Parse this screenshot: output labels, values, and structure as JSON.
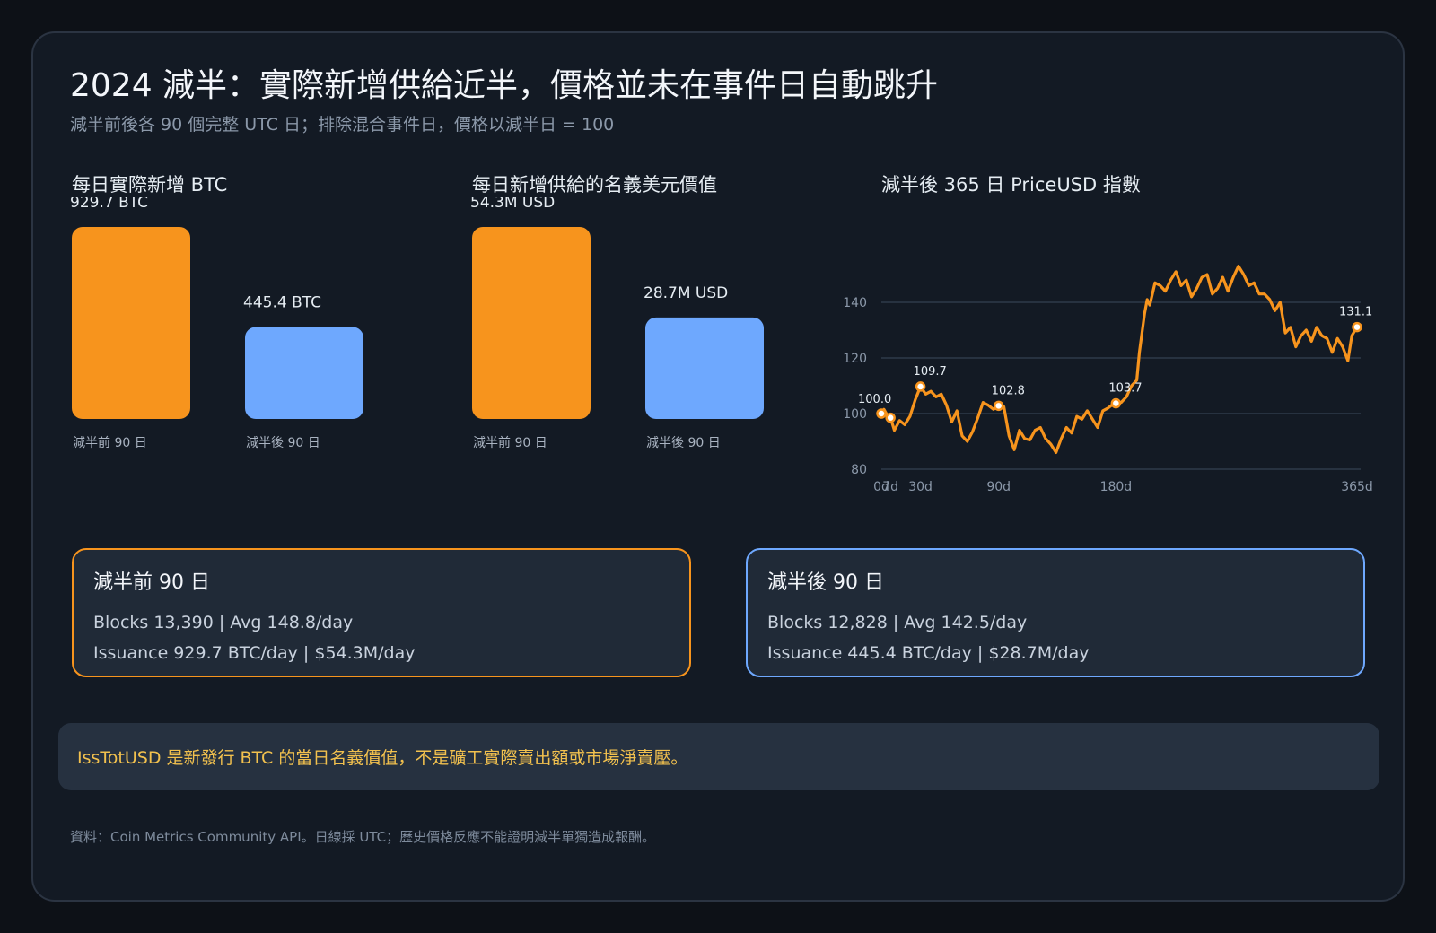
{
  "title": "2024 減半：實際新增供給近半，價格並未在事件日自動跳升",
  "subtitle": "減半前後各 90 個完整 UTC 日；排除混合事件日，價格以減半日 = 100",
  "colors": {
    "pre": "#f7941d",
    "post": "#6ea8fe",
    "line": "#f7941d"
  },
  "panels": {
    "btc": "每日實際新增 BTC",
    "usd": "每日新增供給的名義美元價值",
    "price": "減半後 365 日 PriceUSD 指數"
  },
  "chart_data": [
    {
      "type": "bar",
      "title": "每日實際新增 BTC",
      "categories": [
        "減半前 90 日",
        "減半後 90 日"
      ],
      "values": [
        929.7,
        445.4
      ],
      "labels": [
        "929.7 BTC",
        "445.4 BTC"
      ]
    },
    {
      "type": "bar",
      "title": "每日新增供給的名義美元價值",
      "categories": [
        "減半前 90 日",
        "減半後 90 日"
      ],
      "values": [
        54.3,
        28.7
      ],
      "labels": [
        "54.3M USD",
        "28.7M USD"
      ]
    },
    {
      "type": "line",
      "title": "減半後 365 日 PriceUSD 指數",
      "x_ticks": [
        "0d",
        "7d",
        "30d",
        "90d",
        "180d",
        "365d"
      ],
      "y_ticks": [
        "80",
        "100",
        "120",
        "140"
      ],
      "xlim": [
        0,
        365
      ],
      "ylim": [
        80,
        150
      ],
      "grid": true,
      "series": [
        {
          "x": [
            0,
            2,
            5,
            7,
            10,
            14,
            18,
            22,
            26,
            30,
            34,
            38,
            42,
            46,
            50,
            54,
            58,
            62,
            66,
            70,
            74,
            78,
            82,
            86,
            90,
            94,
            98,
            102,
            106,
            110,
            114,
            118,
            122,
            126,
            130,
            134,
            138,
            142,
            146,
            150,
            154,
            158,
            162,
            166,
            170,
            174,
            178,
            180,
            184,
            188,
            192,
            196,
            198,
            200,
            202,
            204,
            206,
            208,
            210,
            214,
            218,
            222,
            226,
            230,
            234,
            238,
            242,
            246,
            250,
            254,
            258,
            262,
            266,
            270,
            274,
            278,
            282,
            286,
            290,
            294,
            298,
            302,
            306,
            310,
            314,
            318,
            322,
            326,
            330,
            334,
            338,
            342,
            346,
            350,
            354,
            358,
            361,
            365
          ],
          "values": [
            100.0,
            101.5,
            99.0,
            98.5,
            94.0,
            97.5,
            96.0,
            99.0,
            105.0,
            109.7,
            107.0,
            108.0,
            106.0,
            107.0,
            103.0,
            97.0,
            101.0,
            92.0,
            90.0,
            93.5,
            98.5,
            104.0,
            103.0,
            101.5,
            102.8,
            102.5,
            92.0,
            87.0,
            94.0,
            91.0,
            90.5,
            94.0,
            95.0,
            91.0,
            89.0,
            86.0,
            91.0,
            95.0,
            93.0,
            99.0,
            98.0,
            101.0,
            98.0,
            95.0,
            101.0,
            102.0,
            103.5,
            103.7,
            104.0,
            106.0,
            110.0,
            112.0,
            122.0,
            129.0,
            136.0,
            141.0,
            139.0,
            143.0,
            147.0,
            146.0,
            144.0,
            148.0,
            151.0,
            146.0,
            148.0,
            142.0,
            145.0,
            149.0,
            150.0,
            143.0,
            145.0,
            149.0,
            144.0,
            149.0,
            153.0,
            150.0,
            146.0,
            147.0,
            143.0,
            143.0,
            141.0,
            137.0,
            140.0,
            129.0,
            131.0,
            124.0,
            128.0,
            130.0,
            126.0,
            131.0,
            128.0,
            127.0,
            122.0,
            127.0,
            124.0,
            119.0,
            128.0,
            131.1
          ],
          "annotations": [
            {
              "x": 0,
              "y": 100.0,
              "label": "100.0"
            },
            {
              "x": 7,
              "y": 98.5
            },
            {
              "x": 30,
              "y": 109.7,
              "label": "109.7"
            },
            {
              "x": 90,
              "y": 102.8,
              "label": "102.8"
            },
            {
              "x": 180,
              "y": 103.7,
              "label": "103.7"
            },
            {
              "x": 365,
              "y": 131.1,
              "label": "131.1"
            }
          ]
        }
      ]
    }
  ],
  "summary": {
    "pre": {
      "heading": "減半前 90 日",
      "line1": "Blocks 13,390 | Avg 148.8/day",
      "line2": "Issuance 929.7 BTC/day | $54.3M/day"
    },
    "post": {
      "heading": "減半後 90 日",
      "line1": "Blocks 12,828 | Avg 142.5/day",
      "line2": "Issuance 445.4 BTC/day | $28.7M/day"
    }
  },
  "note": "IssTotUSD 是新發行 BTC 的當日名義價值，不是礦工實際賣出額或市場淨賣壓。",
  "footer": "資料：Coin Metrics Community API。日線採 UTC；歷史價格反應不能證明減半單獨造成報酬。"
}
